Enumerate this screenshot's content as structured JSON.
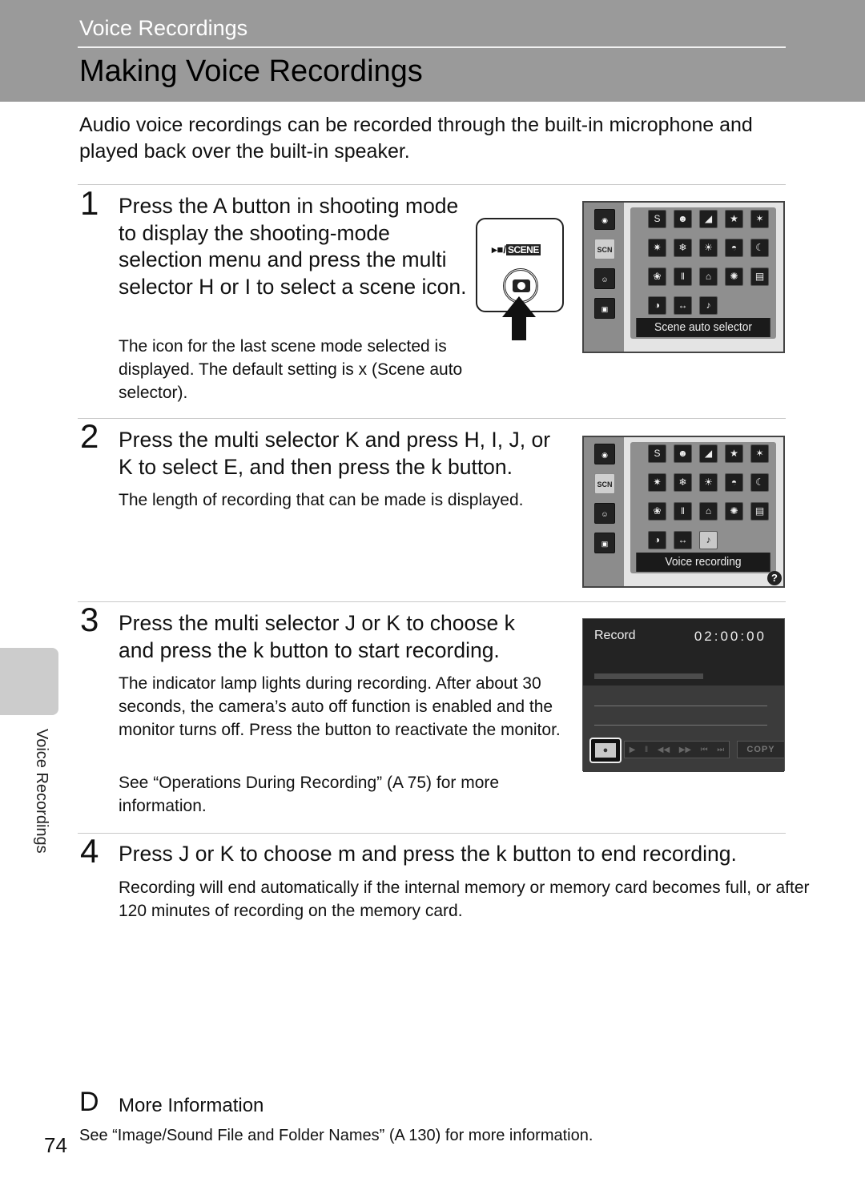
{
  "header": {
    "section": "Voice Recordings",
    "title": "Making Voice Recordings",
    "background_color": "#9a9a9a"
  },
  "intro": "Audio voice recordings can be recorded through the built-in microphone and played back over the built-in speaker.",
  "steps": [
    {
      "number": "1",
      "heading": "Press the A button in shooting mode to display the shooting-mode selection menu and press the multi selector H or I to select a scene icon.",
      "body": [
        "The icon for the last scene mode selected is displayed. The default setting is x (Scene auto selector)."
      ]
    },
    {
      "number": "2",
      "heading": "Press the multi selector K and press H, I, J, or K to select E, and then press the k button.",
      "body": [
        "The length of recording that can be made is displayed."
      ]
    },
    {
      "number": "3",
      "heading": "Press the multi selector J or K to choose k and press the k button to start recording.",
      "body": [
        "The indicator lamp lights during recording. After about 30 seconds, the camera’s auto off function is enabled and the monitor turns off. Press the button to reactivate the monitor.",
        "See “Operations During Recording” (A 75) for more information."
      ]
    },
    {
      "number": "4",
      "heading": "Press J or K to choose m and press the k button to end recording.",
      "body": [
        "Recording will end automatically if the internal memory or memory card becomes full, or after 120 minutes of recording on the memory card."
      ]
    }
  ],
  "button_illustration": {
    "label_prefix": "▸■/",
    "label_scene": "SCENE",
    "icon": "camera-shutter-button"
  },
  "scene_menu_1": {
    "side_icons": [
      "camera",
      "SCENE",
      "smile",
      "movie"
    ],
    "grid": [
      "SCENE",
      "portrait",
      "landscape",
      "sports",
      "night-portrait",
      "party",
      "beach-snow",
      "sunset",
      "dusk",
      "night-landscape",
      "close-up",
      "food",
      "museum",
      "fireworks",
      "copy",
      "backlight",
      "panorama",
      "voice"
    ],
    "caption": "Scene auto selector"
  },
  "scene_menu_2": {
    "side_icons": [
      "camera",
      "SCENE",
      "smile",
      "movie"
    ],
    "grid": [
      "SCENE",
      "portrait",
      "landscape",
      "sports",
      "night-portrait",
      "party",
      "beach-snow",
      "sunset",
      "dusk",
      "night-landscape",
      "close-up",
      "food",
      "museum",
      "fireworks",
      "copy",
      "backlight",
      "panorama",
      "voice"
    ],
    "highlighted": "voice",
    "caption": "Voice recording",
    "help": "?"
  },
  "record_screen": {
    "title": "Record",
    "time": "02:00:00",
    "record_button": "●",
    "transport": [
      "▶",
      "‖",
      "◀◀",
      "▶▶",
      "⏮",
      "⏭"
    ],
    "copy_label": "COPY"
  },
  "side_tab_label": "Voice Recordings",
  "more_info": {
    "marker": "D",
    "title": "More Information",
    "body": "See “Image/Sound File and Folder Names” (A 130) for more information."
  },
  "page_number": "74"
}
